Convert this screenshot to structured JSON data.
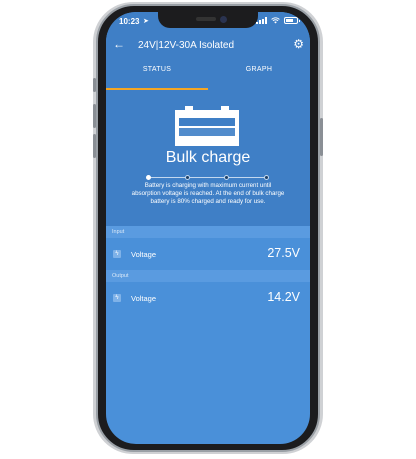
{
  "statusbar": {
    "time": "10:23",
    "location_arrow": "➤"
  },
  "appbar": {
    "back": "←",
    "title": "24V|12V-30A Isolated",
    "settings": "⚙"
  },
  "tabs": [
    {
      "label": "STATUS",
      "active": true
    },
    {
      "label": "GRAPH",
      "active": false
    }
  ],
  "charger": {
    "state": "Bulk charge",
    "stage_index": 0,
    "stage_count": 4,
    "description": "Battery is charging with maximum current until absorption voltage is reached. At the end of bulk charge battery is  80% charged and ready for use."
  },
  "sections": {
    "input": {
      "header": "Input",
      "rows": [
        {
          "label": "Voltage",
          "value": "27.5V",
          "icon": "bolt-icon"
        }
      ]
    },
    "output": {
      "header": "Output",
      "rows": [
        {
          "label": "Voltage",
          "value": "14.2V",
          "icon": "bolt-icon"
        }
      ]
    }
  },
  "colors": {
    "screen_bg": "#4a90d9",
    "header_bg": "#3f7fc6",
    "tab_indicator": "#f5a623",
    "text": "#ffffff"
  }
}
